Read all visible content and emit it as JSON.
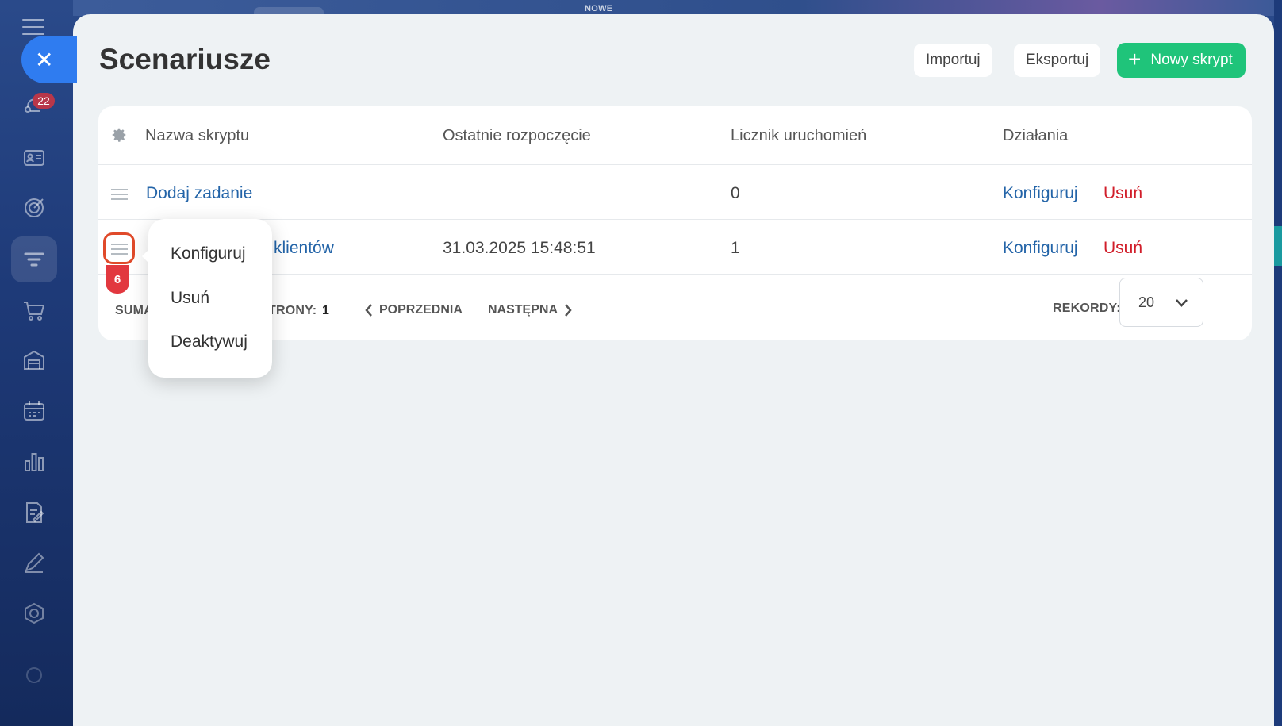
{
  "top_strip": {
    "label": "NOWE"
  },
  "sidebar": {
    "badge_count": "22",
    "icons": [
      "menu-icon",
      "automation-icon",
      "contacts-icon",
      "target-icon",
      "funnel-icon",
      "cart-icon",
      "warehouse-icon",
      "calendar-icon",
      "bar-chart-icon",
      "document-edit-icon",
      "pen-icon",
      "hexagon-icon"
    ]
  },
  "page": {
    "title": "Scenariusze"
  },
  "header": {
    "import_label": "Importuj",
    "export_label": "Eksportuj",
    "new_label": "Nowy skrypt",
    "new_color": "#1fc47a"
  },
  "table": {
    "columns": [
      "Nazwa skryptu",
      "Ostatnie rozpoczęcie",
      "Licznik uruchomień",
      "Działania"
    ],
    "rows": [
      {
        "name": "Dodaj zadanie",
        "last_start": "",
        "count": "0",
        "configure": "Konfiguruj",
        "delete": "Usuń"
      },
      {
        "name": "klientów",
        "last_start": "31.03.2025 15:48:51",
        "count": "1",
        "configure": "Konfiguruj",
        "delete": "Usuń"
      }
    ]
  },
  "step_badge": "6",
  "context_menu": {
    "items": [
      "Konfiguruj",
      "Usuń",
      "Deaktywuj"
    ]
  },
  "footer": {
    "sum_label": "SUMA",
    "pages_label": "TRONY:",
    "pages_value": "1",
    "prev_label": "POPRZEDNIA",
    "next_label": "NASTĘPNA",
    "records_label": "REKORDY:",
    "records_value": "20"
  },
  "colors": {
    "link": "#2364a8",
    "danger": "#d11e2a",
    "accent": "#2f7cf0",
    "highlight": "#e04a2a"
  }
}
